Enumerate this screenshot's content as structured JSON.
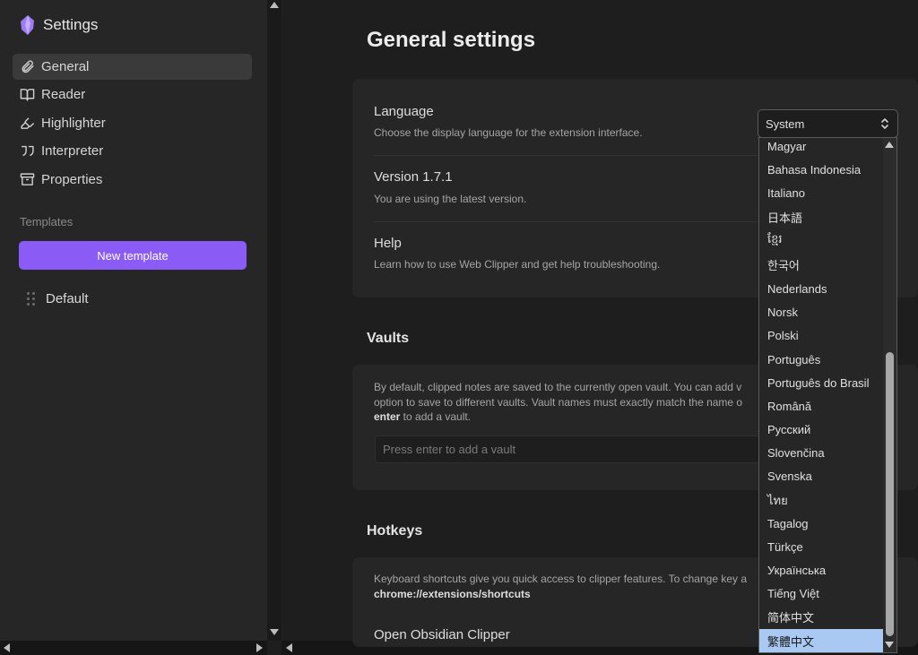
{
  "sidebar": {
    "title": "Settings",
    "nav": [
      {
        "label": "General",
        "icon": "paperclip-icon",
        "active": true
      },
      {
        "label": "Reader",
        "icon": "book-open-icon"
      },
      {
        "label": "Highlighter",
        "icon": "highlighter-icon"
      },
      {
        "label": "Interpreter",
        "icon": "quote-icon"
      },
      {
        "label": "Properties",
        "icon": "archive-icon"
      }
    ],
    "templates_label": "Templates",
    "new_template_label": "New template",
    "templates": [
      {
        "label": "Default"
      }
    ]
  },
  "main": {
    "title": "General settings",
    "general": {
      "language": {
        "name": "Language",
        "desc": "Choose the display language for the extension interface.",
        "selected": "System"
      },
      "version": {
        "name": "Version 1.7.1",
        "desc": "You are using the latest version."
      },
      "help": {
        "name": "Help",
        "desc": "Learn how to use Web Clipper and get help troubleshooting."
      }
    },
    "vaults": {
      "title": "Vaults",
      "desc_line1": "By default, clipped notes are saved to the currently open vault. You can add v",
      "desc_line2": "option to save to different vaults. Vault names must exactly match the name o",
      "desc_line3_bold": "enter",
      "desc_line3_rest": " to add a vault.",
      "input_placeholder": "Press enter to add a vault"
    },
    "hotkeys": {
      "title": "Hotkeys",
      "desc_line1": "Keyboard shortcuts give you quick access to clipper features. To change key a",
      "desc_line2_bold": "chrome://extensions/shortcuts",
      "first_hotkey": "Open Obsidian Clipper"
    }
  },
  "language_options": [
    "Magyar",
    "Bahasa Indonesia",
    "Italiano",
    "日本語",
    "ខ្មែរ",
    "한국어",
    "Nederlands",
    "Norsk",
    "Polski",
    "Português",
    "Português do Brasil",
    "Română",
    "Русский",
    "Slovenčina",
    "Svenska",
    "ไทย",
    "Tagalog",
    "Türkçe",
    "Українська",
    "Tiếng Việt",
    "简体中文",
    "繁體中文"
  ],
  "highlighted_option": "繁體中文",
  "colors": {
    "accent": "#8a5cf5",
    "highlight": "#a9c9f2"
  }
}
